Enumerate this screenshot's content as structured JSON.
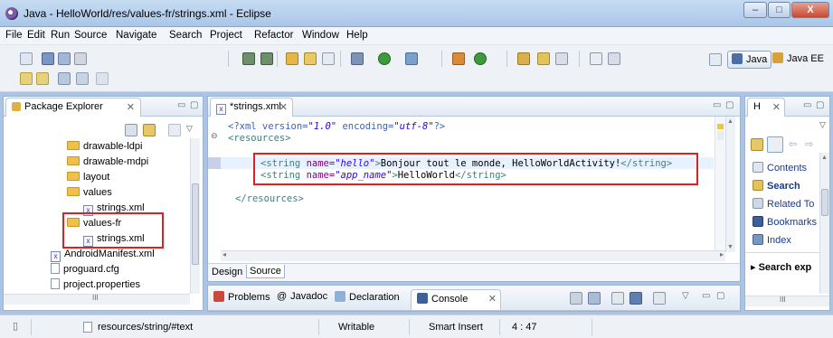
{
  "window": {
    "title": "Java - HelloWorld/res/values-fr/strings.xml - Eclipse",
    "controls": [
      "–",
      "□",
      "X"
    ]
  },
  "menu": [
    "File",
    "Edit",
    "Run",
    "Source",
    "Navigate",
    "Search",
    "Project",
    "Refactor",
    "Window",
    "Help"
  ],
  "perspectives": {
    "java": "Java",
    "javaee": "Java EE"
  },
  "package_explorer": {
    "title": "Package Explorer",
    "items": [
      {
        "label": "drawable-ldpi",
        "kind": "folder"
      },
      {
        "label": "drawable-mdpi",
        "kind": "folder"
      },
      {
        "label": "layout",
        "kind": "folder"
      },
      {
        "label": "values",
        "kind": "folder"
      },
      {
        "label": "strings.xml",
        "kind": "xml"
      },
      {
        "label": "values-fr",
        "kind": "folder"
      },
      {
        "label": "strings.xml",
        "kind": "xml"
      },
      {
        "label": "AndroidManifest.xml",
        "kind": "xml"
      },
      {
        "label": "proguard.cfg",
        "kind": "file"
      },
      {
        "label": "project.properties",
        "kind": "file"
      }
    ],
    "hscroll_mark": "III"
  },
  "editor": {
    "tab_label": "*strings.xml",
    "lines": {
      "l1": {
        "open": "<?xml version=",
        "v1": "\"1.0\"",
        "mid": " encoding=",
        "v2": "\"utf-8\"",
        "close": "?>"
      },
      "l2": {
        "tag": "<resources>"
      },
      "l3": {
        "t1": "<string ",
        "a1": "name=",
        "v1": "\"hello\"",
        "t2": ">",
        "text": "Bonjour tout le monde, HelloWorldActivity!",
        "t3": "</string>"
      },
      "l4": {
        "t1": "<string ",
        "a1": "name=",
        "v1": "\"app_name\"",
        "t2": ">",
        "text": "HelloWorld",
        "t3": "</string>"
      },
      "l5": {
        "tag": "</resources>"
      }
    },
    "bottom_tabs": [
      "Design",
      "Source"
    ]
  },
  "bottom_panel": {
    "tabs": [
      "Problems",
      "Javadoc",
      "Declaration",
      "Console"
    ]
  },
  "help_view": {
    "tab_label": "H",
    "items": [
      "Contents",
      "Search",
      "Related To",
      "Bookmarks",
      "Index"
    ],
    "search_expand": "▸ Search exp",
    "hscroll_mark": "III"
  },
  "status": {
    "path": "resources/string/#text",
    "writable": "Writable",
    "insert_mode": "Smart Insert",
    "position": "4 : 47"
  },
  "colors": {
    "highlight_border": "#e01f1f",
    "xml_tag": "#3f7f7f",
    "xml_attr": "#7f007f",
    "xml_value": "#2a00ff"
  }
}
